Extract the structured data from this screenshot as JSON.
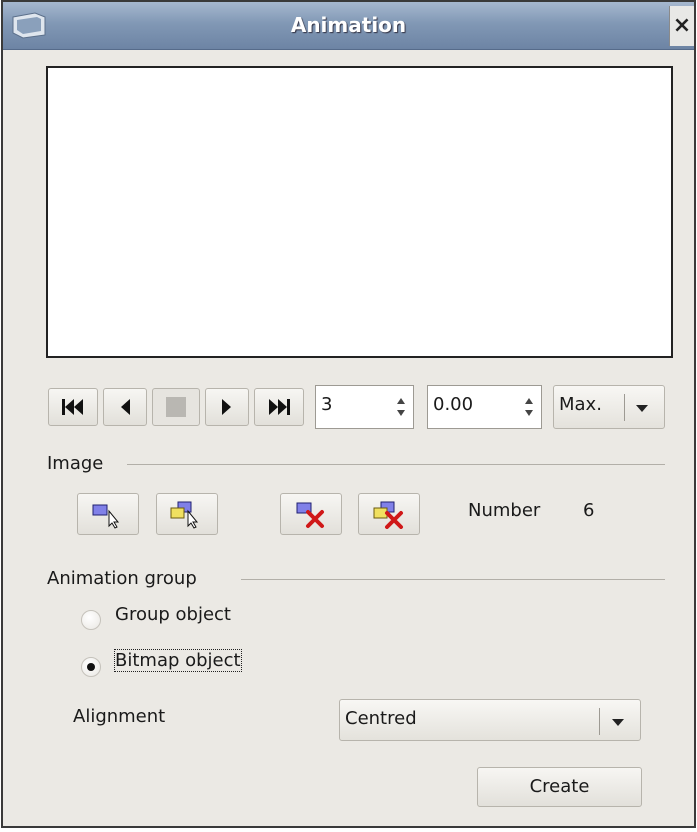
{
  "window": {
    "title": "Animation",
    "close_symbol": "×"
  },
  "playback": {
    "frame_value": "3",
    "duration_value": "0.00",
    "loop_select": "Max.",
    "icons": [
      "first-frame-icon",
      "play-backward-icon",
      "stop-icon",
      "play-icon",
      "last-frame-icon"
    ]
  },
  "image": {
    "group_label": "Image",
    "number_label": "Number",
    "number_value": "6",
    "icons": [
      "apply-object-icon",
      "apply-objects-individually-icon",
      "delete-current-image-icon",
      "delete-all-images-icon"
    ]
  },
  "animation_group": {
    "group_label": "Animation group",
    "radio_group_object": "Group object",
    "radio_bitmap_object": "Bitmap object",
    "selected": "Bitmap object",
    "alignment_label": "Alignment",
    "alignment_value": "Centred"
  },
  "actions": {
    "create_label": "Create"
  },
  "colors": {
    "titlebar": "#8198b5",
    "dialog_bg": "#ebe9e4",
    "delete_red": "#d01818",
    "frame_blue": "#8080e8",
    "frame_yellow": "#f0e060"
  }
}
